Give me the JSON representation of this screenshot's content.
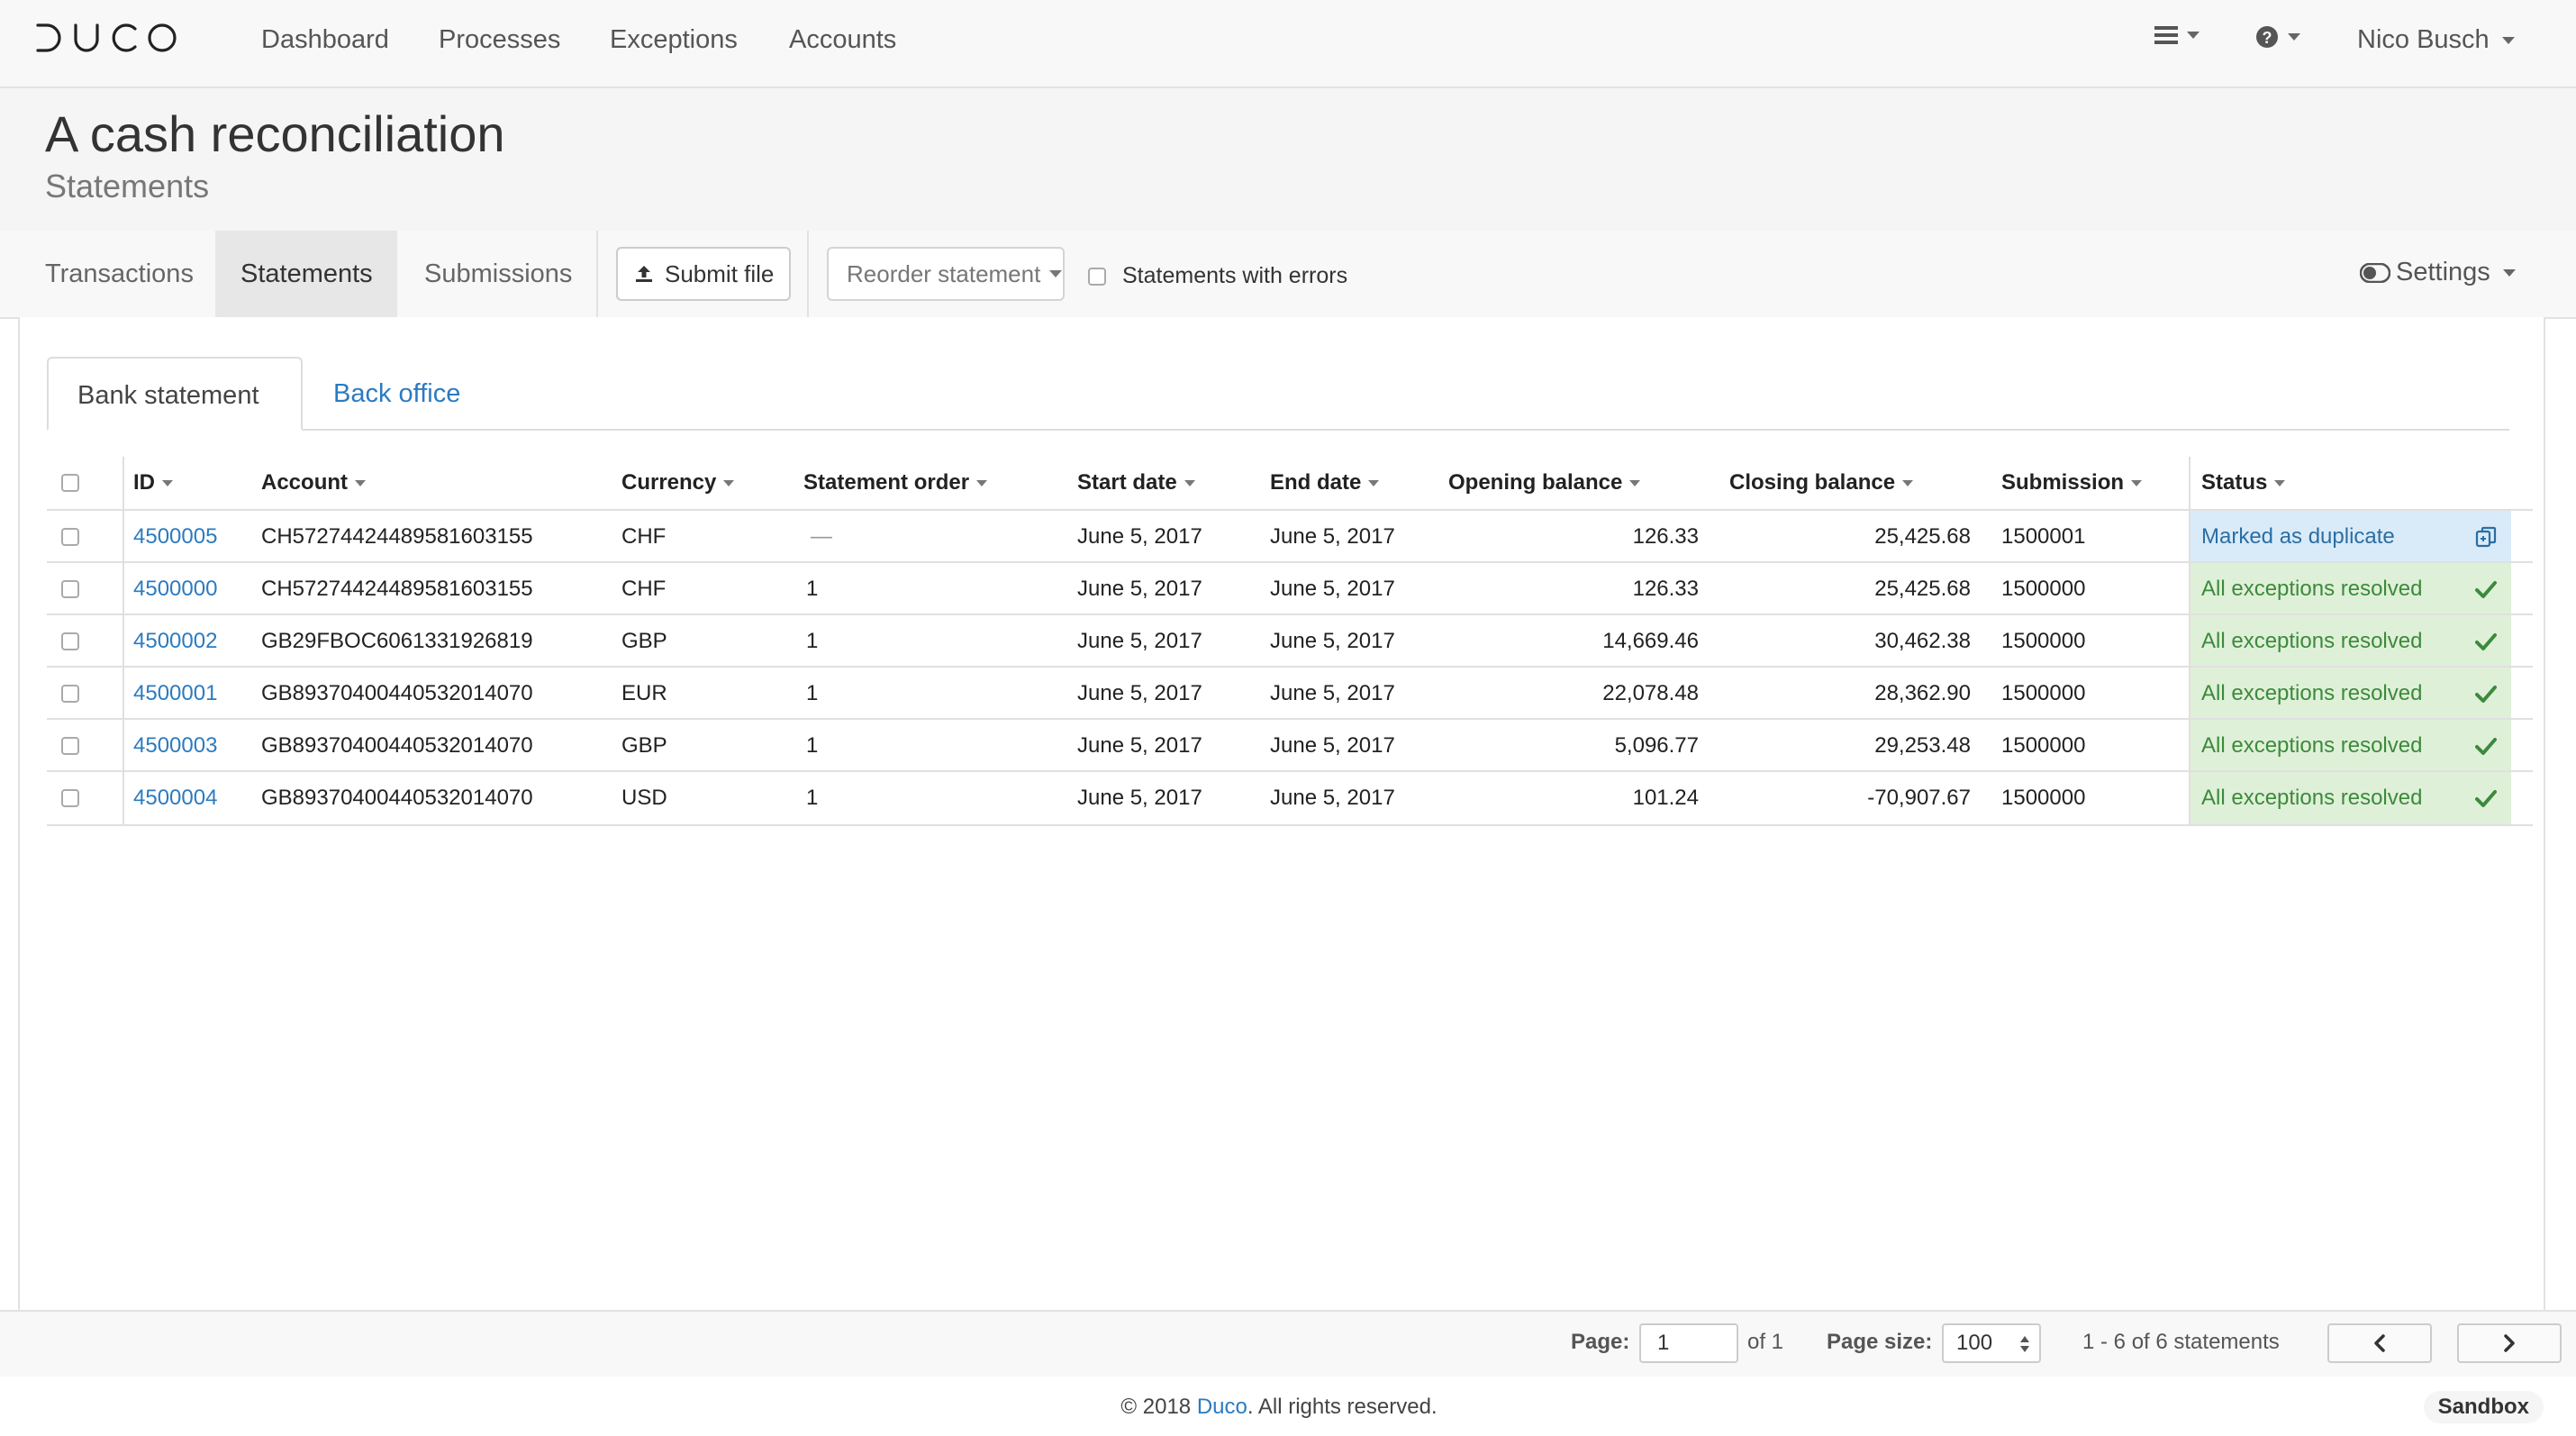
{
  "app": {
    "logo_text": "DUCO",
    "nav": [
      "Dashboard",
      "Processes",
      "Exceptions",
      "Accounts"
    ],
    "user_name": "Nico Busch"
  },
  "header": {
    "title": "A cash reconciliation",
    "subtitle": "Statements"
  },
  "toolbar": {
    "tabs": [
      "Transactions",
      "Statements",
      "Submissions"
    ],
    "active_tab": "Statements",
    "submit_label": "Submit file",
    "reorder_label": "Reorder statement",
    "errors_checkbox_label": "Statements with errors",
    "settings_label": "Settings"
  },
  "view_tabs": {
    "items": [
      "Bank statement",
      "Back office"
    ],
    "active": "Bank statement"
  },
  "table": {
    "columns": [
      "ID",
      "Account",
      "Currency",
      "Statement order",
      "Start date",
      "End date",
      "Opening balance",
      "Closing balance",
      "Submission",
      "Status"
    ],
    "rows": [
      {
        "id": "4500005",
        "account": "CH5727442448958160315 5",
        "currency": "CHF",
        "order": "—",
        "start": "June 5, 2017",
        "end": "June 5, 2017",
        "opening": "126.33",
        "closing": "25,425.68",
        "submission": "1500001",
        "status": "Marked as duplicate",
        "status_type": "duplicate"
      },
      {
        "id": "4500000",
        "account": "CH5727442448958160315 5",
        "currency": "CHF",
        "order": "1",
        "start": "June 5, 2017",
        "end": "June 5, 2017",
        "opening": "126.33",
        "closing": "25,425.68",
        "submission": "1500000",
        "status": "All exceptions resolved",
        "status_type": "resolved"
      },
      {
        "id": "4500002",
        "account": "GB29FBOC6061331926819",
        "currency": "GBP",
        "order": "1",
        "start": "June 5, 2017",
        "end": "June 5, 2017",
        "opening": "14,669.46",
        "closing": "30,462.38",
        "submission": "1500000",
        "status": "All exceptions resolved",
        "status_type": "resolved"
      },
      {
        "id": "4500001",
        "account": "GB89370400440532014070",
        "currency": "EUR",
        "order": "1",
        "start": "June 5, 2017",
        "end": "June 5, 2017",
        "opening": "22,078.48",
        "closing": "28,362.90",
        "submission": "1500000",
        "status": "All exceptions resolved",
        "status_type": "resolved"
      },
      {
        "id": "4500003",
        "account": "GB89370400440532014070",
        "currency": "GBP",
        "order": "1",
        "start": "June 5, 2017",
        "end": "June 5, 2017",
        "opening": "5,096.77",
        "closing": "29,253.48",
        "submission": "1500000",
        "status": "All exceptions resolved",
        "status_type": "resolved"
      },
      {
        "id": "4500004",
        "account": "GB89370400440532014070",
        "currency": "USD",
        "order": "1",
        "start": "June 5, 2017",
        "end": "June 5, 2017",
        "opening": "101.24",
        "closing": "-70,907.67",
        "submission": "1500000",
        "status": "All exceptions resolved",
        "status_type": "resolved"
      }
    ]
  },
  "pager": {
    "page_label": "Page:",
    "page_value": "1",
    "of_label": "of 1",
    "size_label": "Page size:",
    "size_value": "100",
    "summary": "1 - 6 of 6 statements"
  },
  "footer": {
    "prefix": "© 2018 ",
    "link": "Duco",
    "suffix": ". All rights reserved.",
    "env_badge": "Sandbox"
  },
  "colors": {
    "link": "#2b7bc0",
    "duplicate_bg": "#d9ebf8",
    "resolved_bg": "#dff0d8",
    "resolved_text": "#3c8a3c"
  },
  "icons": {
    "hamburger": "menu-icon",
    "help": "question-circle-icon",
    "upload": "upload-icon",
    "toggle": "toggle-icon",
    "duplicate": "copy-icon",
    "resolved": "check-icon",
    "prev": "chevron-left-icon",
    "next": "chevron-right-icon"
  }
}
